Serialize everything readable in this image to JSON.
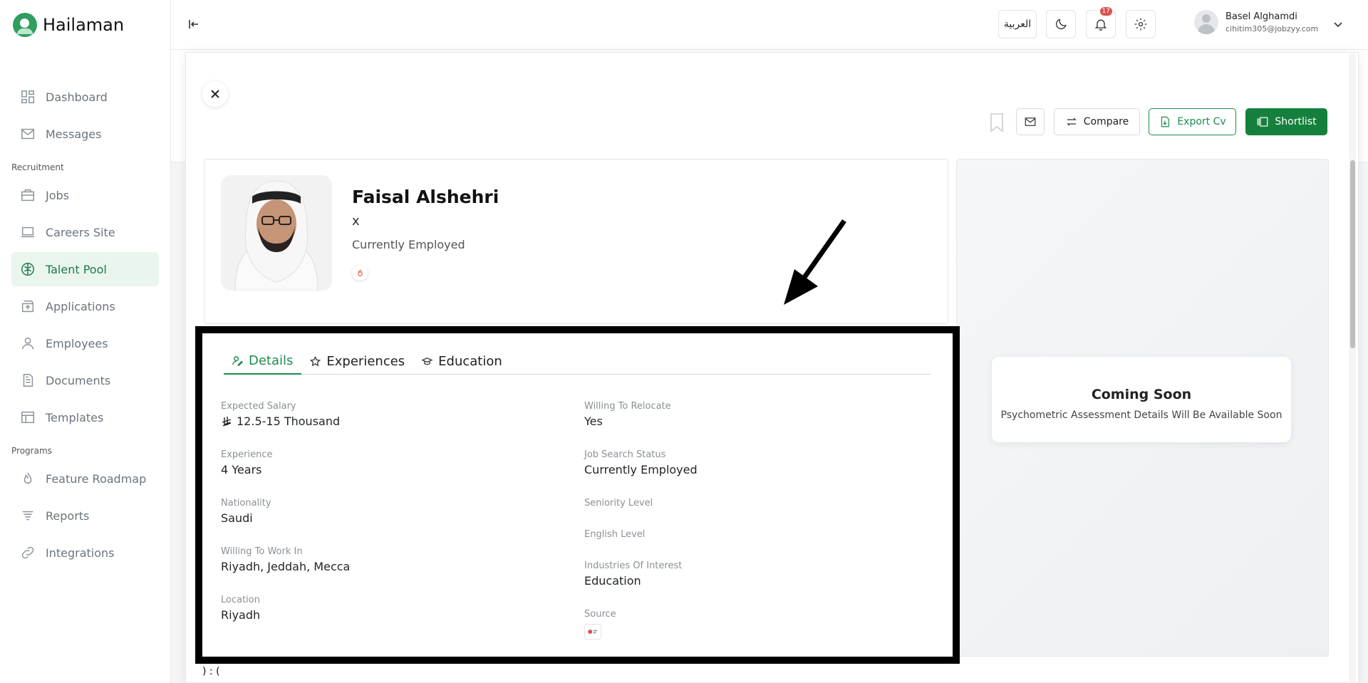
{
  "brand": {
    "name": "Hailaman"
  },
  "sidebar": {
    "items": [
      {
        "label": "Dashboard",
        "icon": "dashboard-icon"
      },
      {
        "label": "Messages",
        "icon": "mail-icon"
      }
    ],
    "sections": [
      {
        "title": "Recruitment",
        "items": [
          {
            "label": "Jobs",
            "icon": "briefcase-icon"
          },
          {
            "label": "Careers Site",
            "icon": "laptop-icon"
          },
          {
            "label": "Talent Pool",
            "icon": "brain-icon",
            "active": true
          },
          {
            "label": "Applications",
            "icon": "inbox-icon"
          },
          {
            "label": "Employees",
            "icon": "person-icon"
          },
          {
            "label": "Documents",
            "icon": "document-icon"
          },
          {
            "label": "Templates",
            "icon": "template-icon"
          }
        ]
      },
      {
        "title": "Programs",
        "items": [
          {
            "label": "Feature Roadmap",
            "icon": "flame-icon"
          },
          {
            "label": "Reports",
            "icon": "filter-list-icon"
          },
          {
            "label": "Integrations",
            "icon": "link-icon"
          }
        ]
      }
    ]
  },
  "topbar": {
    "language_label": "العربية",
    "notifications_count": "17",
    "user": {
      "name": "Basel Alghamdi",
      "email": "cihitim305@jobzyy.com"
    }
  },
  "actions": {
    "compare_label": "Compare",
    "export_label": "Export Cv",
    "shortlist_label": "Shortlist"
  },
  "candidate": {
    "name": "Faisal Alshehri",
    "title": "x",
    "status": "Currently Employed"
  },
  "tabs": [
    {
      "label": "Details",
      "icon": "details-icon",
      "active": true
    },
    {
      "label": "Experiences",
      "icon": "star-icon"
    },
    {
      "label": "Education",
      "icon": "graduation-cap-icon"
    }
  ],
  "details": {
    "left": [
      {
        "label": "Expected Salary",
        "value": "12.5-15 Thousand",
        "currency_icon": "riyal-icon"
      },
      {
        "label": "Experience",
        "value": "4 Years"
      },
      {
        "label": "Nationality",
        "value": "Saudi"
      },
      {
        "label": "Willing To Work In",
        "value": "Riyadh, Jeddah, Mecca"
      },
      {
        "label": "Location",
        "value": "Riyadh"
      }
    ],
    "right": [
      {
        "label": "Willing To Relocate",
        "value": "Yes"
      },
      {
        "label": "Job Search Status",
        "value": "Currently Employed"
      },
      {
        "label": "Seniority Level",
        "value": ""
      },
      {
        "label": "English Level",
        "value": ""
      },
      {
        "label": "Industries Of Interest",
        "value": "Education"
      },
      {
        "label": "Source",
        "value": ""
      }
    ]
  },
  "psychometric": {
    "title": "Coming Soon",
    "subtitle": "Psychometric Assessment Details Will Be Available Soon"
  },
  "bottom_text": ") : (",
  "colors": {
    "accent": "#15803d",
    "active_bg": "#eaf5ee",
    "badge": "#d9534f"
  }
}
